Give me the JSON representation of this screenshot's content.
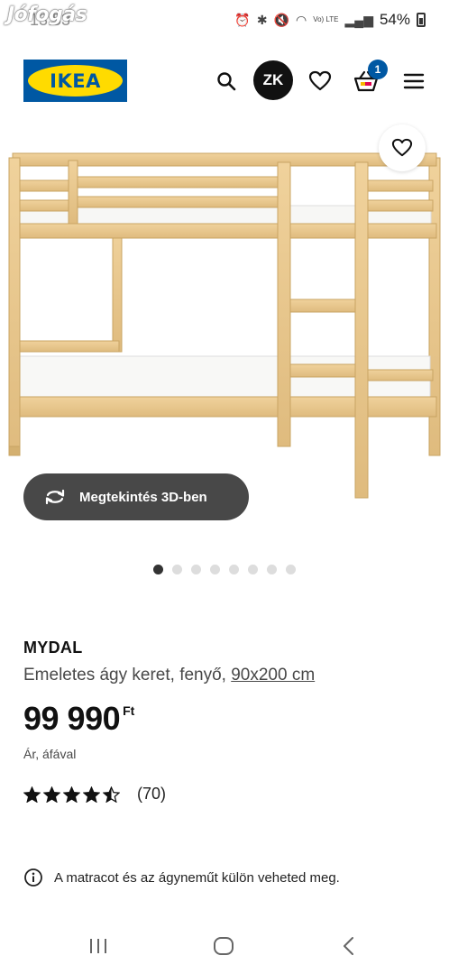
{
  "status_bar": {
    "watermark": "Jófogás",
    "time": "13:53",
    "network": "Vo) LTE",
    "battery": "54%"
  },
  "header": {
    "logo_text": "IKEA",
    "avatar_initials": "ZK",
    "cart_count": "1",
    "icons": [
      "search-icon",
      "heart-icon",
      "basket-icon",
      "menu-icon"
    ]
  },
  "gallery": {
    "view_3d_label": "Megtekintés 3D-ben",
    "dot_count": 8,
    "active_index": 0
  },
  "product": {
    "name": "MYDAL",
    "description": "Emeletes ágy keret, fenyő, ",
    "size": "90x200 cm",
    "price": "99 990",
    "currency": "Ft",
    "vat_note": "Ár, áfával",
    "rating": 4.5,
    "rating_max": 5,
    "review_count": "(70)"
  },
  "notice": {
    "text": "A matracot és az ágyneműt külön veheted meg."
  },
  "colors": {
    "ikea_blue": "#0058a3",
    "ikea_yellow": "#ffdb00",
    "button_dark": "#484848",
    "wood": "#e8c88e"
  }
}
